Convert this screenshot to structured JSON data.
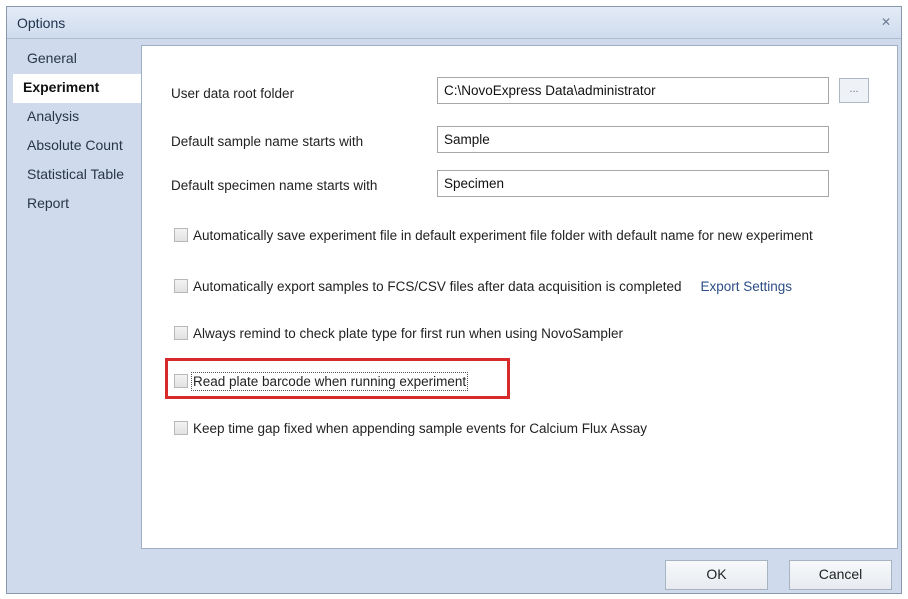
{
  "window": {
    "title": "Options",
    "close_glyph": "✕"
  },
  "sidebar": {
    "items": [
      {
        "label": "General",
        "active": false
      },
      {
        "label": "Experiment",
        "active": true
      },
      {
        "label": "Analysis",
        "active": false
      },
      {
        "label": "Absolute Count",
        "active": false
      },
      {
        "label": "Statistical Table",
        "active": false
      },
      {
        "label": "Report",
        "active": false
      }
    ]
  },
  "fields": {
    "root_folder": {
      "label": "User data root folder",
      "value": "C:\\NovoExpress Data\\administrator",
      "browse_label": "..."
    },
    "sample_name": {
      "label": "Default sample name starts with",
      "value": "Sample"
    },
    "specimen_name": {
      "label": "Default specimen name starts with",
      "value": "Specimen"
    }
  },
  "options": [
    {
      "label": "Automatically save experiment file in default experiment file folder with default name for new experiment",
      "checked": false
    },
    {
      "label": "Automatically export samples to FCS/CSV files after data acquisition is completed",
      "checked": false,
      "link": "Export Settings"
    },
    {
      "label": "Always remind to check plate type for first run when using NovoSampler",
      "checked": false
    },
    {
      "label": "Read plate barcode when running experiment",
      "checked": false
    },
    {
      "label": "Keep time gap fixed when appending sample events for Calcium Flux Assay",
      "checked": false
    }
  ],
  "buttons": {
    "ok": "OK",
    "cancel": "Cancel"
  },
  "colors": {
    "highlight": "#d72a2a",
    "sidebar_bg": "#cfdbec",
    "link": "#2c4d85"
  }
}
